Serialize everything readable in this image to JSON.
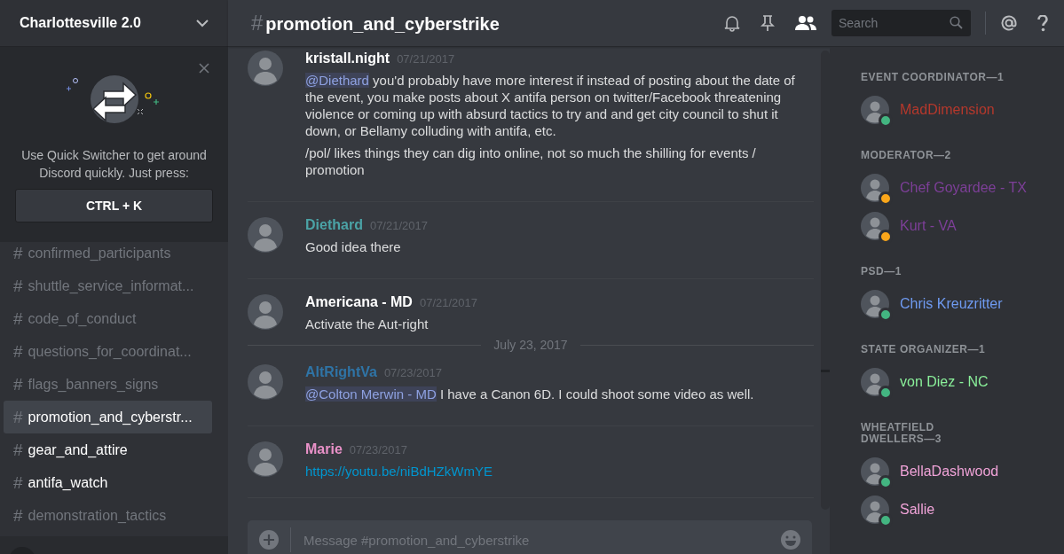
{
  "server": {
    "name": "Charlottesville 2.0"
  },
  "quick_switcher": {
    "message": "Use Quick Switcher to get around Discord quickly. Just press:",
    "shortcut": "CTRL + K"
  },
  "channels": [
    {
      "hash": "#",
      "name": "confirmed_participants",
      "selected": false,
      "unread": false
    },
    {
      "hash": "#",
      "name": "shuttle_service_informat...",
      "selected": false,
      "unread": false
    },
    {
      "hash": "#",
      "name": "code_of_conduct",
      "selected": false,
      "unread": false
    },
    {
      "hash": "#",
      "name": "questions_for_coordinat...",
      "selected": false,
      "unread": false
    },
    {
      "hash": "#",
      "name": "flags_banners_signs",
      "selected": false,
      "unread": false
    },
    {
      "hash": "#",
      "name": "promotion_and_cyberstr...",
      "selected": true,
      "unread": false
    },
    {
      "hash": "#",
      "name": "gear_and_attire",
      "selected": false,
      "unread": true
    },
    {
      "hash": "#",
      "name": "antifa_watch",
      "selected": false,
      "unread": true
    },
    {
      "hash": "#",
      "name": "demonstration_tactics",
      "selected": false,
      "unread": false
    }
  ],
  "channel_header": {
    "hash": "#",
    "name": "promotion_and_cyberstrike"
  },
  "header_search": {
    "placeholder": "Search"
  },
  "messages": [
    {
      "kind": "message",
      "author": "kristall.night",
      "color": "#ffffff",
      "date": "07/21/2017",
      "paragraphs": [
        {
          "mention": "@Diethard",
          "text": " you'd probably have more interest if instead of posting about the date of the event, you make posts about X antifa person on twitter/Facebook threatening violence or coming up with absurd tactics to try and and get city council to shut it down, or Bellamy colluding with antifa, etc."
        },
        {
          "text": "/pol/ likes things they can dig into online, not so much the shilling for events / promotion"
        }
      ]
    },
    {
      "kind": "message",
      "author": "Diethard",
      "color": "#4ba3a6",
      "date": "07/21/2017",
      "paragraphs": [
        {
          "text": "Good idea there"
        }
      ]
    },
    {
      "kind": "message",
      "author": "Americana - MD",
      "color": "#ffffff",
      "date": "07/21/2017",
      "paragraphs": [
        {
          "text": "Activate the Aut-right"
        }
      ]
    },
    {
      "kind": "date_divider",
      "label": "July 23, 2017"
    },
    {
      "kind": "message",
      "author": "AltRightVa",
      "color": "#2f74a6",
      "date": "07/23/2017",
      "paragraphs": [
        {
          "mention": "@Colton Merwin - MD",
          "text": " I have a Canon 6D. I could shoot some video as well."
        }
      ]
    },
    {
      "kind": "message",
      "author": "Marie",
      "color": "#e991c8",
      "date": "07/23/2017",
      "paragraphs": [
        {
          "link": "https://youtu.be/niBdHZkWmYE"
        }
      ]
    }
  ],
  "composer": {
    "placeholder": "Message #promotion_and_cyberstrike"
  },
  "member_groups": [
    {
      "title": "EVENT COORDINATOR—1",
      "members": [
        {
          "name": "MadDimension",
          "color": "#b5382c",
          "idle": false
        }
      ]
    },
    {
      "title": "MODERATOR—2",
      "members": [
        {
          "name": "Chef Goyardee - TX",
          "color": "#7d3f98",
          "idle": true
        },
        {
          "name": "Kurt - VA",
          "color": "#7d3f98",
          "idle": true
        }
      ]
    },
    {
      "title": "PSD—1",
      "members": [
        {
          "name": "Chris Kreuzritter",
          "color": "#6f9bf2",
          "idle": false
        }
      ]
    },
    {
      "title": "STATE ORGANIZER—1",
      "members": [
        {
          "name": "von Diez - NC",
          "color": "#8af09a",
          "idle": false
        }
      ]
    },
    {
      "title": "WHEATFIELD\nDWELLERS—3",
      "members": [
        {
          "name": "BellaDashwood",
          "color": "#f0a3d8",
          "idle": false
        },
        {
          "name": "Sallie",
          "color": "#f0a3d8",
          "idle": false
        }
      ]
    }
  ]
}
